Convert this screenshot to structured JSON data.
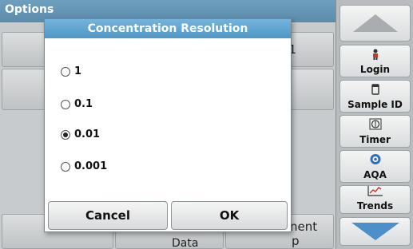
{
  "screen": {
    "title": "Options",
    "background_fragments": {
      "row1_right": "1",
      "bottom_right": "nent",
      "bottom_right_2": "p",
      "bottom_middle": "Data"
    }
  },
  "dialog": {
    "title": "Concentration Resolution",
    "options": [
      {
        "label": "1",
        "selected": false
      },
      {
        "label": "0.1",
        "selected": false
      },
      {
        "label": "0.01",
        "selected": true
      },
      {
        "label": "0.001",
        "selected": false
      }
    ],
    "cancel_label": "Cancel",
    "ok_label": "OK"
  },
  "sidebar": {
    "items": [
      {
        "label": "Login",
        "icon": "person-icon"
      },
      {
        "label": "Sample ID",
        "icon": "vial-icon"
      },
      {
        "label": "Timer",
        "icon": "timer-icon"
      },
      {
        "label": "AQA",
        "icon": "aqa-icon"
      },
      {
        "label": "Trends",
        "icon": "trends-icon"
      }
    ]
  },
  "colors": {
    "title_bar": "#5b8aab",
    "dialog_title": "#4f97c6",
    "background": "#c8cbcd"
  }
}
